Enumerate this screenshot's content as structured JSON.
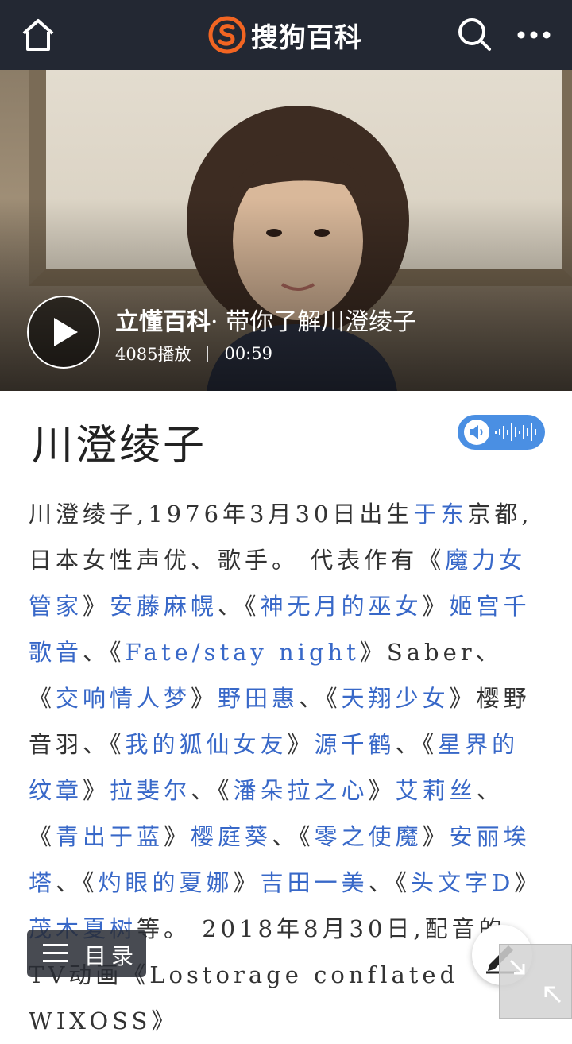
{
  "header": {
    "brand": "搜狗百科",
    "icons": [
      "home-icon",
      "sogou-logo-icon",
      "search-icon",
      "more-icon"
    ],
    "background": "#232833",
    "logo_color": "#f26522"
  },
  "video": {
    "brand": "立懂百科",
    "title": "· 带你了解川澄绫子",
    "plays": "4085播放",
    "duration": "00:59"
  },
  "entry": {
    "title": "川澄绫子",
    "audio_icon": "speaker-wave-icon",
    "accent": "#4a8fe3"
  },
  "body": {
    "segments": [
      {
        "t": "川澄绫子,1976年3月30日出生",
        "link": false
      },
      {
        "t": "于东",
        "link": true
      },
      {
        "t": "京都,日本女性声优、歌手。 代表作有《",
        "link": false
      },
      {
        "t": "魔力女管家",
        "link": true
      },
      {
        "t": "》",
        "link": false
      },
      {
        "t": "安藤麻幌",
        "link": true
      },
      {
        "t": "、《",
        "link": false
      },
      {
        "t": "神无月的巫女",
        "link": true
      },
      {
        "t": "》",
        "link": false
      },
      {
        "t": "姬宫千歌音",
        "link": true
      },
      {
        "t": "、《",
        "link": false
      },
      {
        "t": "Fate/stay night",
        "link": true
      },
      {
        "t": "》Saber、《",
        "link": false
      },
      {
        "t": "交响情人梦",
        "link": true
      },
      {
        "t": "》",
        "link": false
      },
      {
        "t": "野田惠",
        "link": true
      },
      {
        "t": "、《",
        "link": false
      },
      {
        "t": "天翔少女",
        "link": true
      },
      {
        "t": "》樱野音羽、《",
        "link": false
      },
      {
        "t": "我的狐仙女友",
        "link": true
      },
      {
        "t": "》",
        "link": false
      },
      {
        "t": "源千鹤",
        "link": true
      },
      {
        "t": "、《",
        "link": false
      },
      {
        "t": "星界的纹章",
        "link": true
      },
      {
        "t": "》",
        "link": false
      },
      {
        "t": "拉斐尔",
        "link": true
      },
      {
        "t": "、《",
        "link": false
      },
      {
        "t": "潘朵拉之心",
        "link": true
      },
      {
        "t": "》",
        "link": false
      },
      {
        "t": "艾莉丝",
        "link": true
      },
      {
        "t": "、《",
        "link": false
      },
      {
        "t": "青出于蓝",
        "link": true
      },
      {
        "t": "》",
        "link": false
      },
      {
        "t": "樱庭葵",
        "link": true
      },
      {
        "t": "、《",
        "link": false
      },
      {
        "t": "零之使魔",
        "link": true
      },
      {
        "t": "》",
        "link": false
      },
      {
        "t": "安丽埃塔",
        "link": true
      },
      {
        "t": "、《",
        "link": false
      },
      {
        "t": "灼眼的夏娜",
        "link": true
      },
      {
        "t": "》",
        "link": false
      },
      {
        "t": "吉田一美",
        "link": true
      },
      {
        "t": "、《",
        "link": false
      },
      {
        "t": "头文字D",
        "link": true
      },
      {
        "t": "》",
        "link": false
      },
      {
        "t": "茂木夏树",
        "link": true
      },
      {
        "t": "等。 2018年8月30日,配音的TV动画《Lostorage conflated WIXOSS》",
        "link": false
      }
    ]
  },
  "floating": {
    "toc_label": "目录",
    "icons": [
      "menu-lines-icon",
      "edit-pen-icon",
      "collapse-arrow-icon"
    ]
  }
}
